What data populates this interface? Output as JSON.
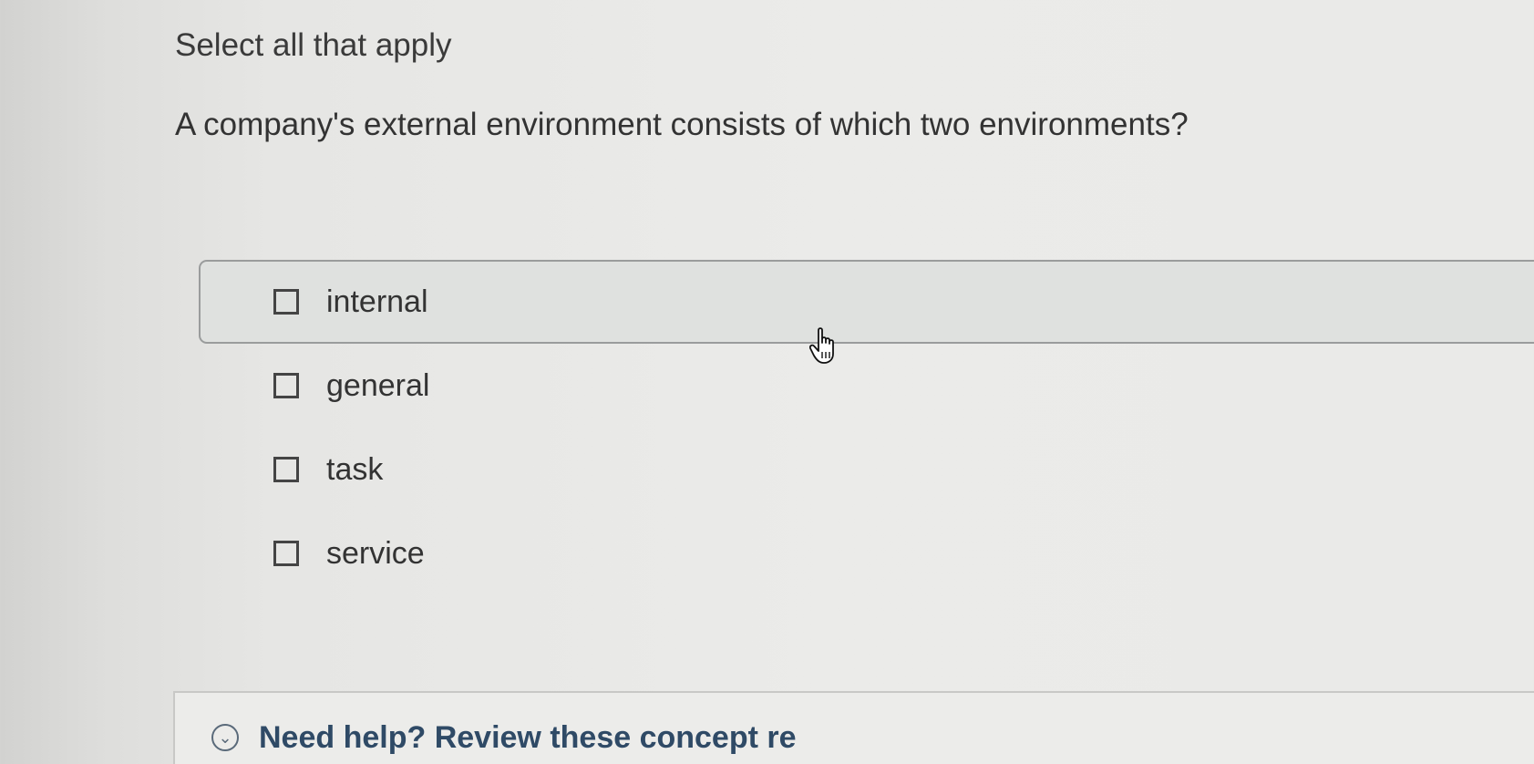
{
  "instruction": "Select all that apply",
  "question": "A company's external environment consists of which two environments?",
  "options": [
    {
      "label": "internal",
      "checked": false
    },
    {
      "label": "general",
      "checked": false
    },
    {
      "label": "task",
      "checked": false
    },
    {
      "label": "service",
      "checked": false
    }
  ],
  "help": {
    "icon": "chevron-down-circle-icon",
    "text": "Need help? Review these concept re"
  },
  "colors": {
    "help_text": "#2f4a66",
    "hover_background": "#dfe1df"
  }
}
